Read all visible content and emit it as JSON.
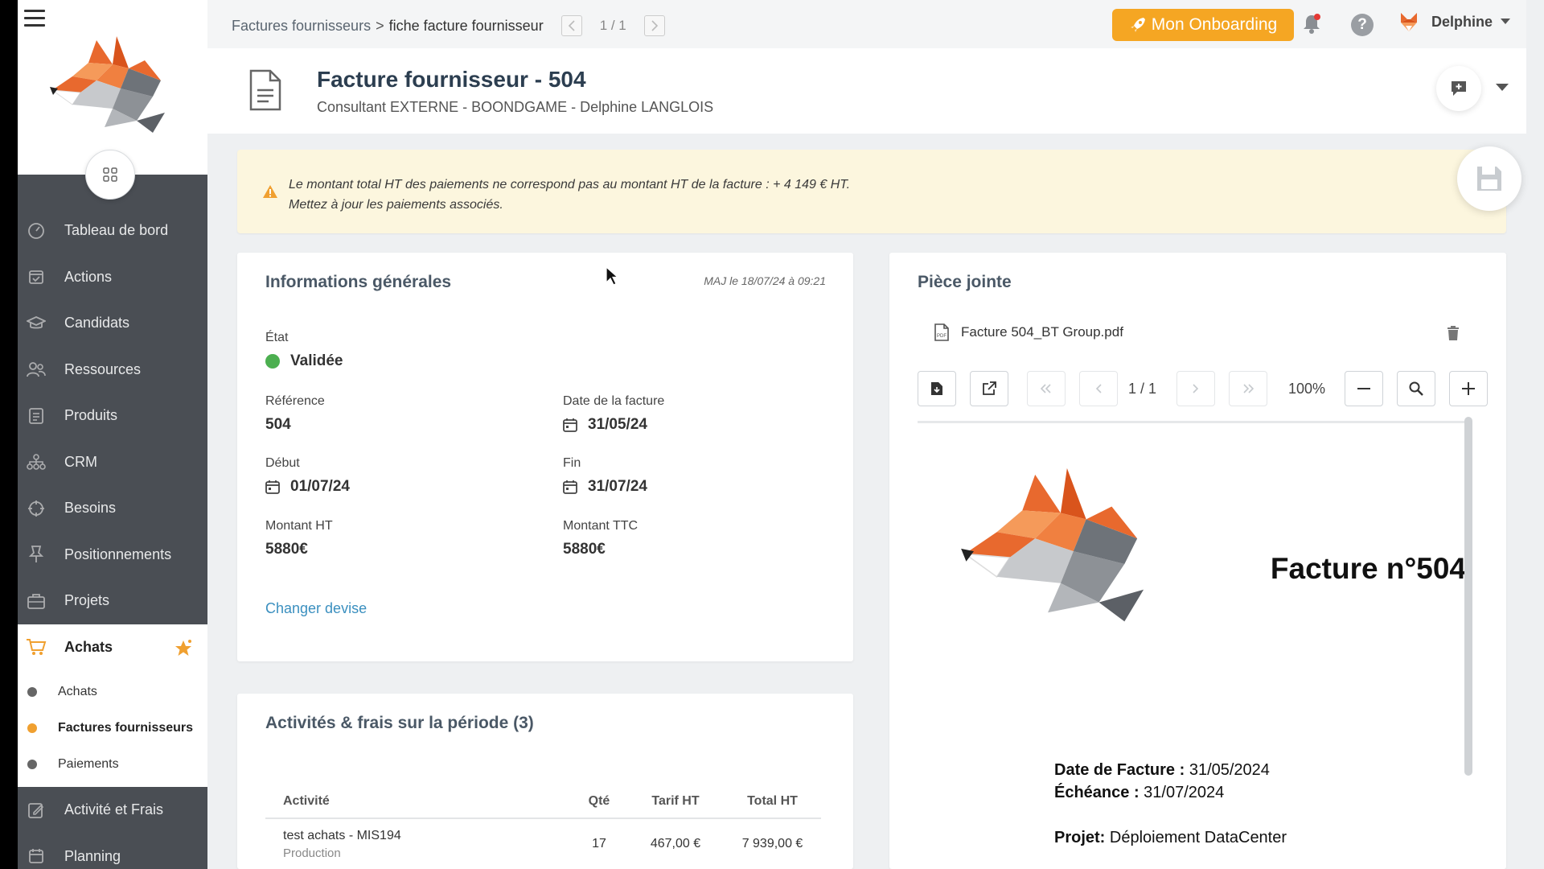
{
  "sidebar": {
    "items": [
      {
        "label": "Tableau de bord",
        "icon": "dashboard-icon"
      },
      {
        "label": "Actions",
        "icon": "calendar-check-icon"
      },
      {
        "label": "Candidats",
        "icon": "graduation-cap-icon"
      },
      {
        "label": "Ressources",
        "icon": "people-icon"
      },
      {
        "label": "Produits",
        "icon": "document-list-icon"
      },
      {
        "label": "CRM",
        "icon": "org-chart-icon"
      },
      {
        "label": "Besoins",
        "icon": "crosshair-icon"
      },
      {
        "label": "Positionnements",
        "icon": "pin-icon"
      },
      {
        "label": "Projets",
        "icon": "briefcase-icon"
      }
    ],
    "active": {
      "label": "Achats",
      "icon": "cart-icon"
    },
    "sub_items": [
      "Achats",
      "Factures fournisseurs",
      "Paiements"
    ],
    "current_sub": "Factures fournisseurs",
    "after": [
      {
        "label": "Activité et Frais",
        "icon": "edit-icon"
      },
      {
        "label": "Planning",
        "icon": "calendar-icon"
      }
    ]
  },
  "topbar": {
    "breadcrumb_link": "Factures fournisseurs",
    "breadcrumb_sep": ">",
    "breadcrumb_current": "fiche facture fournisseur",
    "page_indicator": "1 / 1",
    "onboarding_label": "Mon Onboarding",
    "help_label": "?",
    "user_name": "Delphine"
  },
  "header": {
    "title": "Facture fournisseur - 504",
    "subtitle": "Consultant EXTERNE - BOONDGAME - Delphine LANGLOIS"
  },
  "warning": {
    "line1": "Le montant total HT des paiements ne correspond pas au montant HT de la facture : + 4 149 € HT.",
    "line2": "Mettez à jour les paiements associés."
  },
  "info": {
    "title": "Informations générales",
    "updated": "MAJ le 18/07/24 à 09:21",
    "etat_label": "État",
    "etat_value": "Validée",
    "reference_label": "Référence",
    "reference_value": "504",
    "date_facture_label": "Date de la facture",
    "date_facture_value": "31/05/24",
    "debut_label": "Début",
    "debut_value": "01/07/24",
    "fin_label": "Fin",
    "fin_value": "31/07/24",
    "montant_ht_label": "Montant HT",
    "montant_ht_value": "5880€",
    "montant_ttc_label": "Montant TTC",
    "montant_ttc_value": "5880€",
    "changer_devise": "Changer devise"
  },
  "attachment": {
    "title": "Pièce jointe",
    "file_name": "Facture 504_BT Group.pdf",
    "page": "1 / 1",
    "zoom": "100%",
    "pdf": {
      "title": "Facture n°504",
      "date_label": "Date de Facture :",
      "date_value": "31/05/2024",
      "echeance_label": "Échéance :",
      "echeance_value": "31/07/2024",
      "projet_label": "Projet:",
      "projet_value": "Déploiement DataCenter"
    }
  },
  "activities": {
    "title": "Activités & frais sur la période (3)",
    "columns": [
      "Activité",
      "Qté",
      "Tarif HT",
      "Total HT"
    ],
    "rows": [
      {
        "name": "test achats - MIS194",
        "type": "Production",
        "qty": "17",
        "tarif": "467,00 €",
        "total": "7 939,00 €"
      }
    ]
  },
  "colors": {
    "sidebar_bg": "#4a4e54",
    "onboarding": "#f5a623",
    "valid_status": "#4caf50",
    "warning_bg": "#fcf6de",
    "link": "#3a8fbf"
  }
}
